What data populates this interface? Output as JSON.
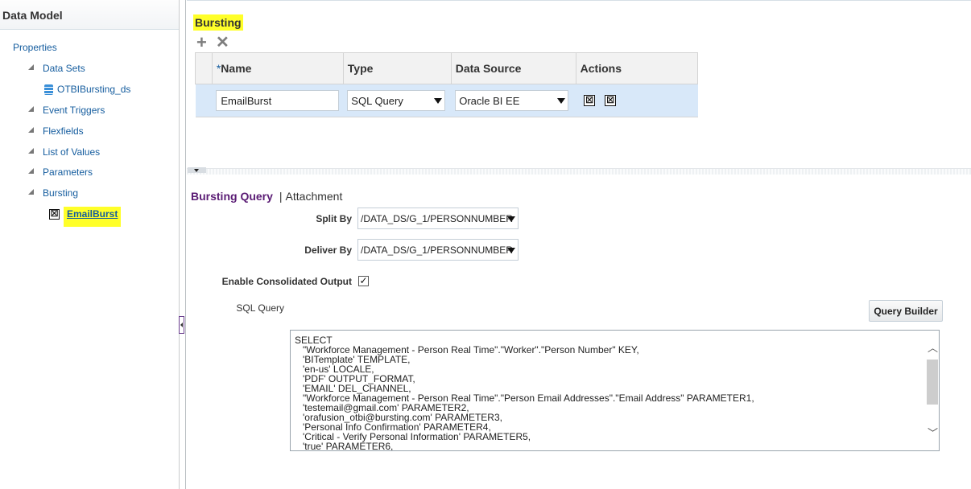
{
  "left": {
    "title": "Data Model",
    "items": {
      "properties": "Properties",
      "data_sets": "Data Sets",
      "dataset_name": "OTBIBursting_ds",
      "event_triggers": "Event Triggers",
      "flexfields": "Flexfields",
      "list_of_values": "List of Values",
      "parameters": "Parameters",
      "bursting": "Bursting",
      "burst_item": "EmailBurst"
    }
  },
  "main": {
    "title": "Bursting",
    "toolbar": {
      "add_icon": "+",
      "delete_icon": "✕"
    },
    "table": {
      "columns": {
        "required_mark": "*",
        "name": "Name",
        "type": "Type",
        "data_source": "Data Source",
        "actions": "Actions"
      },
      "row": {
        "name": "EmailBurst",
        "type": "SQL Query",
        "data_source": "Oracle BI EE"
      },
      "action_icons": [
        "☒",
        "☒"
      ]
    },
    "subtabs": {
      "active": "Bursting Query",
      "separator": "|",
      "other": "Attachment"
    },
    "form": {
      "split_by_label": "Split By",
      "split_by_value": "/DATA_DS/G_1/PERSONNUMBER",
      "deliver_by_label": "Deliver By",
      "deliver_by_value": "/DATA_DS/G_1/PERSONNUMBER",
      "consolidated_label": "Enable Consolidated Output",
      "consolidated_checked": "✓",
      "sql_query_label": "SQL Query",
      "query_builder": "Query Builder"
    },
    "sql": "SELECT\n   \"Workforce Management - Person Real Time\".\"Worker\".\"Person Number\" KEY,\n   'BITemplate' TEMPLATE,\n   'en-us' LOCALE,\n   'PDF' OUTPUT_FORMAT,\n   'EMAIL' DEL_CHANNEL,\n   \"Workforce Management - Person Real Time\".\"Person Email Addresses\".\"Email Address\" PARAMETER1,\n   'testemail@gmail.com' PARAMETER2,\n   'orafusion_otbi@bursting.com' PARAMETER3,\n   'Personal Info Confirmation' PARAMETER4,\n   'Critical - Verify Personal Information' PARAMETER5,\n   'true' PARAMETER6,"
  }
}
